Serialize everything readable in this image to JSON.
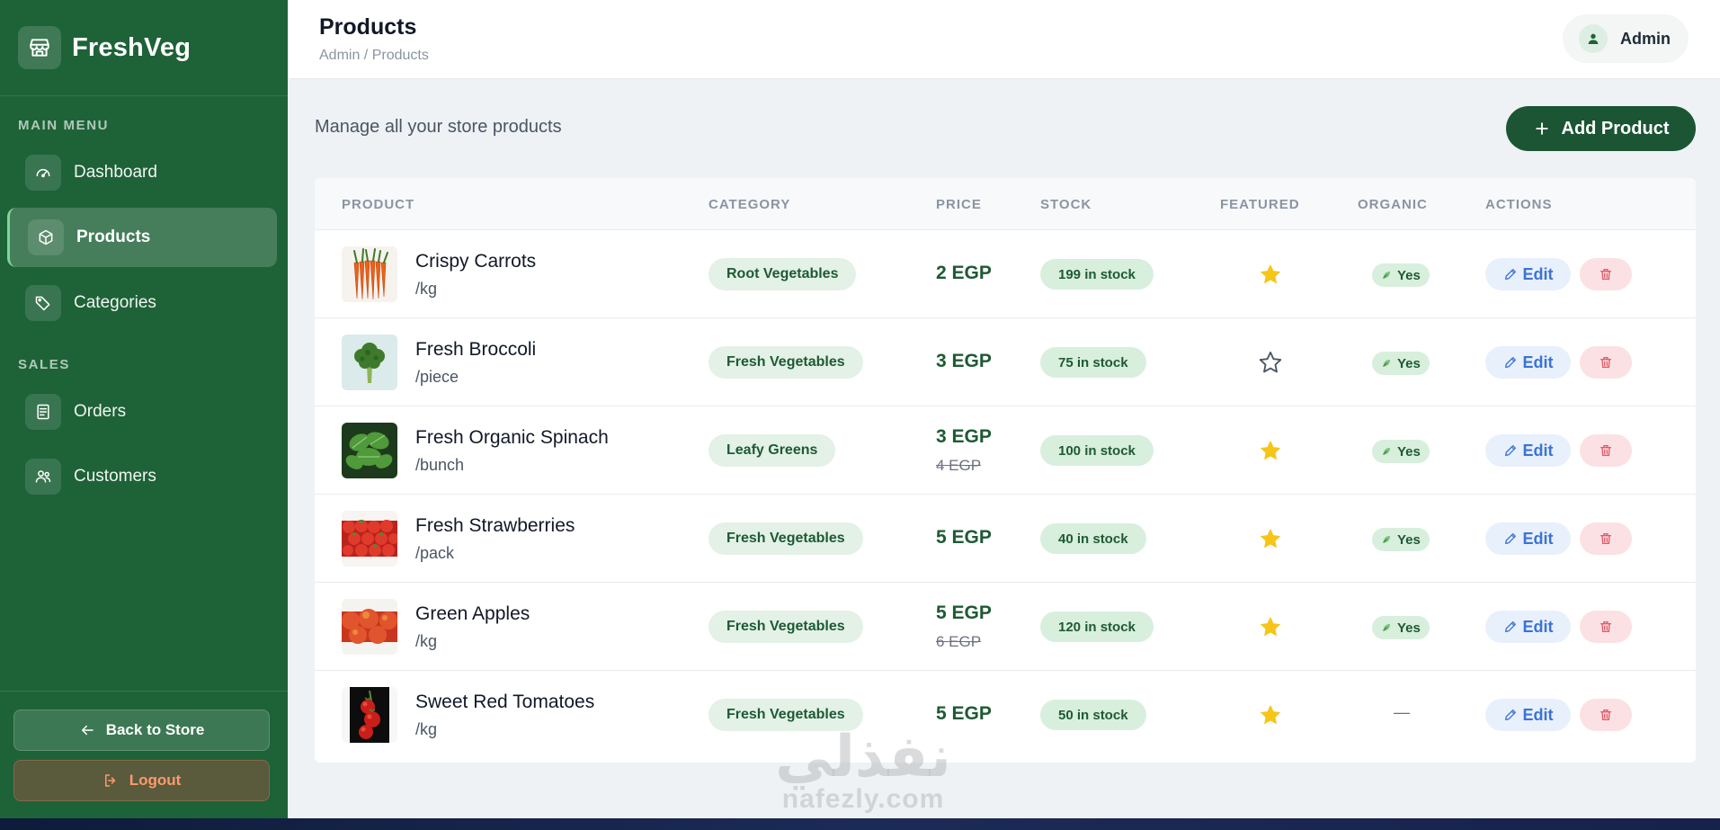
{
  "brand": {
    "name": "FreshVeg"
  },
  "sidebar": {
    "sections": [
      {
        "label": "MAIN MENU"
      },
      {
        "label": "SALES"
      }
    ],
    "items": [
      {
        "label": "Dashboard",
        "icon": "gauge-icon",
        "active": false
      },
      {
        "label": "Products",
        "icon": "box-icon",
        "active": true
      },
      {
        "label": "Categories",
        "icon": "tags-icon",
        "active": false
      },
      {
        "label": "Orders",
        "icon": "receipt-icon",
        "active": false
      },
      {
        "label": "Customers",
        "icon": "users-icon",
        "active": false
      }
    ],
    "back_label": "Back to Store",
    "logout_label": "Logout"
  },
  "header": {
    "title": "Products",
    "breadcrumb": "Admin / Products",
    "user": "Admin"
  },
  "main": {
    "subtitle": "Manage all your store products",
    "add_label": "Add Product",
    "columns": [
      "PRODUCT",
      "CATEGORY",
      "PRICE",
      "STOCK",
      "FEATURED",
      "ORGANIC",
      "ACTIONS"
    ],
    "edit_label": "Edit",
    "products": [
      {
        "name": "Crispy Carrots",
        "unit": "/kg",
        "category": "Root Vegetables",
        "price": "2 EGP",
        "old_price": "",
        "stock": "199 in stock",
        "featured": true,
        "organic": "Yes"
      },
      {
        "name": "Fresh Broccoli",
        "unit": "/piece",
        "category": "Fresh Vegetables",
        "price": "3 EGP",
        "old_price": "",
        "stock": "75 in stock",
        "featured": false,
        "organic": "Yes"
      },
      {
        "name": "Fresh Organic Spinach",
        "unit": "/bunch",
        "category": "Leafy Greens",
        "price": "3 EGP",
        "old_price": "4 EGP",
        "stock": "100 in stock",
        "featured": true,
        "organic": "Yes"
      },
      {
        "name": "Fresh Strawberries",
        "unit": "/pack",
        "category": "Fresh Vegetables",
        "price": "5 EGP",
        "old_price": "",
        "stock": "40 in stock",
        "featured": true,
        "organic": "Yes"
      },
      {
        "name": "Green Apples",
        "unit": "/kg",
        "category": "Fresh Vegetables",
        "price": "5 EGP",
        "old_price": "6 EGP",
        "stock": "120 in stock",
        "featured": true,
        "organic": "Yes"
      },
      {
        "name": "Sweet Red Tomatoes",
        "unit": "/kg",
        "category": "Fresh Vegetables",
        "price": "5 EGP",
        "old_price": "",
        "stock": "50 in stock",
        "featured": true,
        "organic": "—"
      }
    ]
  },
  "watermark": {
    "arabic": "نفذلي",
    "latin": "nafezly.com"
  },
  "colors": {
    "sidebar": "#1e6238",
    "accent": "#1b5534",
    "star": "#f5c518",
    "edit": "#3b73d6",
    "delete": "#e05b6a"
  }
}
